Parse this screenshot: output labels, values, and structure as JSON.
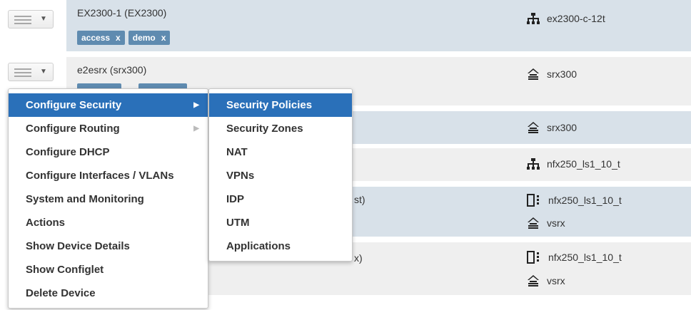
{
  "rows": [
    {
      "name": "EX2300-1 (EX2300)",
      "tags": [
        "access",
        "demo"
      ],
      "models": [
        "ex2300-c-12t"
      ],
      "icons": [
        "switch-icon"
      ]
    },
    {
      "name": "e2esrx (srx300)",
      "models": [
        "srx300"
      ],
      "icons": [
        "firewall-icon"
      ]
    },
    {
      "models": [
        "srx300"
      ],
      "icons": [
        "firewall-icon"
      ]
    },
    {
      "models": [
        "nfx250_ls1_10_t"
      ],
      "icons": [
        "switch-icon"
      ]
    },
    {
      "name_tail": "st)",
      "models": [
        "nfx250_ls1_10_t",
        "vsrx"
      ],
      "icons": [
        "nfx-device-icon",
        "firewall-icon"
      ]
    },
    {
      "name_tail": "x)",
      "models": [
        "nfx250_ls1_10_t",
        "vsrx"
      ],
      "icons": [
        "nfx-device-icon",
        "firewall-icon"
      ]
    }
  ],
  "tag_remove_glyph": "x",
  "context_menu": {
    "items": [
      "Configure Security",
      "Configure Routing",
      "Configure DHCP",
      "Configure Interfaces / VLANs",
      "System and Monitoring",
      "Actions",
      "Show Device Details",
      "Show Configlet",
      "Delete Device"
    ],
    "active": "Configure Security"
  },
  "submenu": {
    "items": [
      "Security Policies",
      "Security Zones",
      "NAT",
      "VPNs",
      "IDP",
      "UTM",
      "Applications"
    ],
    "active": "Security Policies"
  },
  "colors": {
    "accent": "#2a70b9",
    "row_blue": "#d8e1e9",
    "row_grey": "#efefef",
    "tag": "#5f8bb0"
  }
}
